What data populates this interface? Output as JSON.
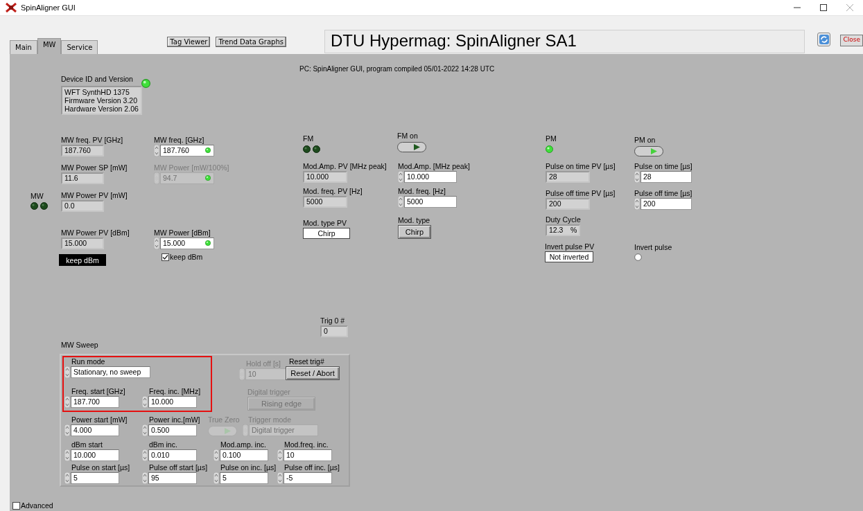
{
  "window": {
    "title": "SpinAligner GUI"
  },
  "tabs": [
    {
      "label": "Main",
      "selected": false
    },
    {
      "label": "MW",
      "selected": true
    },
    {
      "label": "Service",
      "selected": false
    }
  ],
  "toolbar": {
    "buttons": [
      "Tag Viewer",
      "Trend Data Graphs"
    ]
  },
  "header": {
    "title": "DTU Hypermag: SpinAligner SA1",
    "close_button": "Close"
  },
  "panel": {
    "note": "PC: SpinAligner GUI, program compiled 05/01-2022 14:28 UTC",
    "sweep": {
      "title": "MW Sweep",
      "highlight": true
    },
    "widgets": [
      {
        "kind": "textbox",
        "label": "Device ID and Version",
        "lines": [
          "WFT SynthHD 1375",
          "Firmware Version 3.20",
          "Hardware Version 2.06"
        ],
        "led_on": true,
        "disabled": false
      },
      {
        "kind": "indicator",
        "label": "MW freq. PV [GHz]",
        "value": "187.760",
        "disabled": false
      },
      {
        "kind": "indicator",
        "label": "MW Power SP [mW]",
        "value": "11.6",
        "disabled": false
      },
      {
        "kind": "leds",
        "label": "MW",
        "leds": [
          {
            "on": false
          },
          {
            "on": false
          }
        ],
        "disabled": false
      },
      {
        "kind": "indicator",
        "label": "MW Power PV [mW]",
        "value": "0.0",
        "disabled": false
      },
      {
        "kind": "indicator",
        "label": "MW Power PV [dBm]",
        "value": "15.000",
        "disabled": false
      },
      {
        "kind": "dark_button",
        "text": "keep dBm",
        "disabled": false
      },
      {
        "kind": "control",
        "label": "MW freq. [GHz]",
        "value": "187.760",
        "led_on": true,
        "disabled": false
      },
      {
        "kind": "control",
        "label": "MW Power [mW/100%]",
        "value": "94.7",
        "led_on": true,
        "disabled": true
      },
      {
        "kind": "control",
        "label": "MW Power [dBm]",
        "value": "15.000",
        "led_on": true,
        "disabled": false
      },
      {
        "kind": "checkbox",
        "text": "keep dBm",
        "checked": true,
        "disabled": false
      },
      {
        "kind": "leds",
        "label": "FM",
        "leds": [
          {
            "on": false
          },
          {
            "on": false
          }
        ],
        "disabled": false
      },
      {
        "kind": "indicator",
        "label": "Mod.Amp. PV [MHz peak]",
        "value": "10.000",
        "disabled": false
      },
      {
        "kind": "indicator",
        "label": "Mod. freq. PV [Hz]",
        "value": "5000",
        "disabled": false
      },
      {
        "kind": "string",
        "label": "Mod. type PV",
        "value": "Chirp",
        "disabled": false
      },
      {
        "kind": "toggle",
        "label": "FM on",
        "on": false,
        "disabled": false
      },
      {
        "kind": "control",
        "label": "Mod.Amp. [MHz peak]",
        "value": "10.000",
        "disabled": false
      },
      {
        "kind": "control",
        "label": "Mod. freq. [Hz]",
        "value": "5000",
        "disabled": false
      },
      {
        "kind": "button",
        "label": "Mod. type",
        "text": "Chirp",
        "disabled": false
      },
      {
        "kind": "leds",
        "label": "PM",
        "leds": [
          {
            "on": true
          }
        ],
        "disabled": false
      },
      {
        "kind": "indicator",
        "label": "Pulse on time PV [µs]",
        "value": "28",
        "disabled": false
      },
      {
        "kind": "indicator",
        "label": "Pulse off time PV [µs]",
        "value": "200",
        "disabled": false
      },
      {
        "kind": "indicator",
        "label": "Duty Cycle",
        "value": "12.3",
        "unit": "%",
        "disabled": false
      },
      {
        "kind": "string",
        "label": "Invert pulse PV",
        "value": "Not inverted",
        "disabled": false
      },
      {
        "kind": "toggle",
        "label": "PM on",
        "on": true,
        "disabled": false
      },
      {
        "kind": "control",
        "label": "Pulse on time [µs]",
        "value": "28",
        "disabled": false
      },
      {
        "kind": "control",
        "label": "Pulse off time [µs]",
        "value": "200",
        "disabled": false
      },
      {
        "kind": "radio",
        "label": "Invert pulse",
        "on": false,
        "disabled": false
      },
      {
        "kind": "indicator",
        "label": "Trig 0 #",
        "value": "0",
        "disabled": false
      },
      {
        "kind": "control",
        "label": "Run mode",
        "value": "Stationary, no sweep",
        "disabled": false
      },
      {
        "kind": "control",
        "label": "Freq. start [GHz]",
        "value": "187.700",
        "disabled": false
      },
      {
        "kind": "control",
        "label": "Freq. inc. [MHz]",
        "value": "10.000",
        "disabled": false
      },
      {
        "kind": "control",
        "label": "Hold off [s]",
        "value": "10",
        "disabled": true
      },
      {
        "kind": "button",
        "label": "Reset trig#",
        "text": "Reset / Abort",
        "disabled": false
      },
      {
        "kind": "button",
        "label": "Digital trigger",
        "text": "Rising edge",
        "disabled": true
      },
      {
        "kind": "control",
        "label": "Power start [mW]",
        "value": "4.000",
        "disabled": false
      },
      {
        "kind": "control",
        "label": "Power inc.[mW]",
        "value": "0.500",
        "disabled": false
      },
      {
        "kind": "toggle",
        "label": "True Zero",
        "on": true,
        "disabled": true
      },
      {
        "kind": "control",
        "label": "Trigger mode",
        "value": "Digital trigger",
        "disabled": true
      },
      {
        "kind": "control",
        "label": "dBm start",
        "value": "10.000",
        "disabled": false
      },
      {
        "kind": "control",
        "label": "dBm inc.",
        "value": "0.010",
        "disabled": false
      },
      {
        "kind": "control",
        "label": "Mod.amp. inc.",
        "value": "0.100",
        "disabled": false
      },
      {
        "kind": "control",
        "label": "Mod.freq. inc.",
        "value": "10",
        "disabled": false
      },
      {
        "kind": "control",
        "label": "Pulse on start [µs]",
        "value": "5",
        "disabled": false
      },
      {
        "kind": "control",
        "label": "Pulse off start [µs]",
        "value": "95",
        "disabled": false
      },
      {
        "kind": "control",
        "label": "Pulse on inc. [µs]",
        "value": "5",
        "disabled": false
      },
      {
        "kind": "control",
        "label": "Pulse off inc. [µs]",
        "value": "-5",
        "disabled": false
      },
      {
        "kind": "checkbox",
        "text": "Advanced",
        "checked": false,
        "disabled": false
      }
    ]
  }
}
